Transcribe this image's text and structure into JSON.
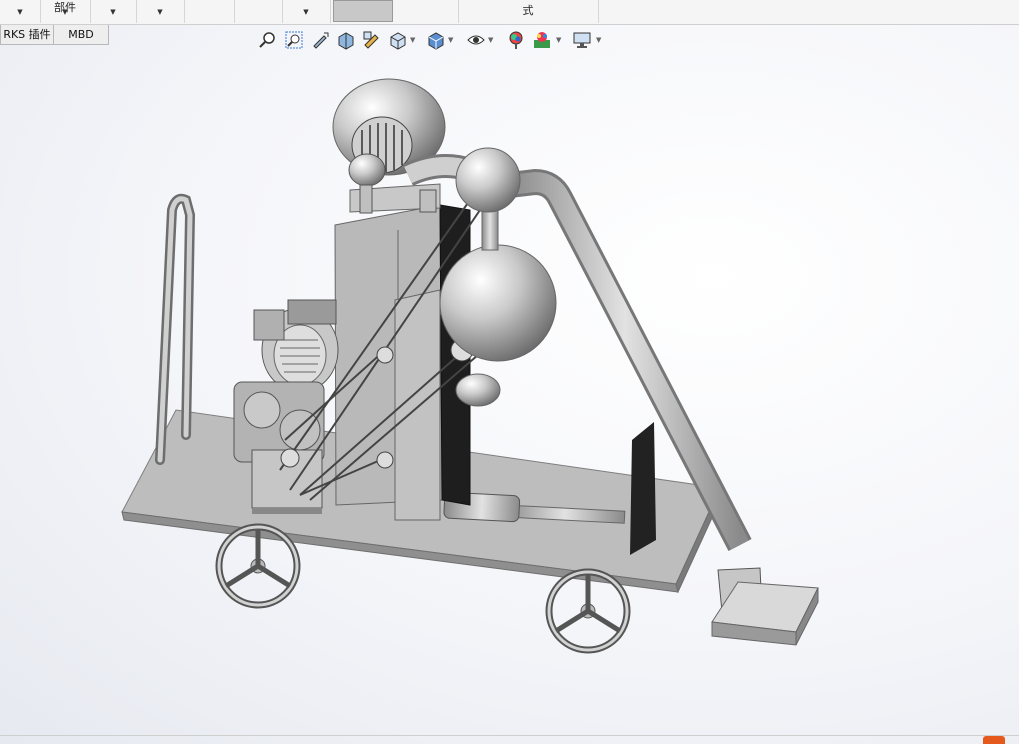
{
  "ribbon": {
    "items": [
      {
        "label": "",
        "has_dropdown": true
      },
      {
        "label": "部件",
        "has_dropdown": true
      },
      {
        "label": "",
        "has_dropdown": true
      },
      {
        "label": "",
        "has_dropdown": true
      },
      {
        "label": "",
        "has_dropdown": false
      },
      {
        "label": "",
        "has_dropdown": false
      },
      {
        "label": "",
        "has_dropdown": true
      },
      {
        "label": "",
        "has_dropdown": false,
        "selected": true
      },
      {
        "label": "",
        "has_dropdown": false
      },
      {
        "label": "式",
        "has_dropdown": false
      }
    ]
  },
  "tabs": [
    {
      "label": "RKS 插件"
    },
    {
      "label": "MBD"
    }
  ],
  "heads_up_toolbar": {
    "icons": [
      "zoom-to-fit-icon",
      "zoom-to-area-icon",
      "previous-view-icon",
      "section-view-icon",
      "dynamic-annotation-view-icon",
      "view-orientation-icon",
      "display-style-icon",
      "hide-show-items-icon",
      "edit-appearance-icon",
      "apply-scene-icon",
      "view-settings-icon"
    ]
  },
  "model": {
    "description_name": "mobile-blower-cart-assembly",
    "colors": {
      "body": "#c4c4c4",
      "dark": "#7a7a7a",
      "shadow": "#333333"
    }
  }
}
